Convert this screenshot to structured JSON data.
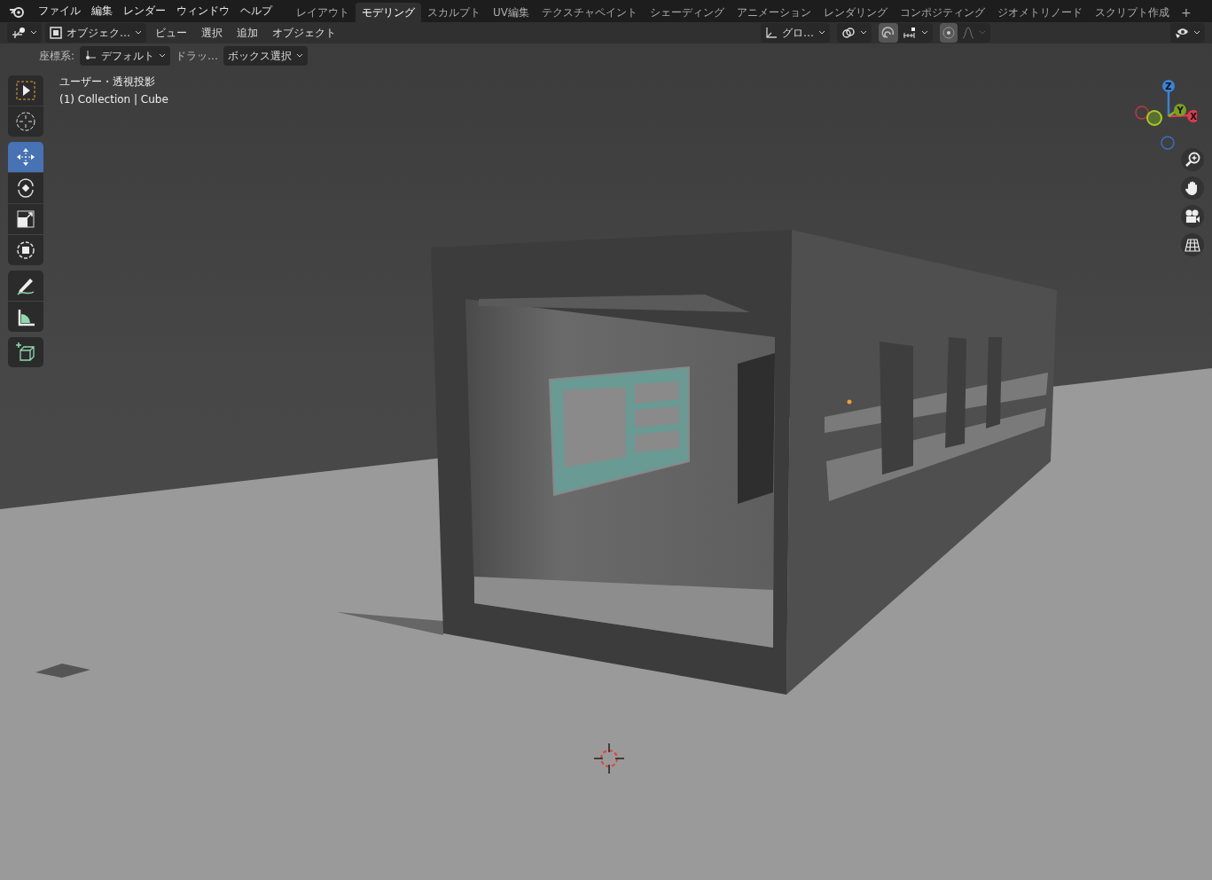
{
  "menu": {
    "items": [
      "ファイル",
      "編集",
      "レンダー",
      "ウィンドウ",
      "ヘルプ"
    ]
  },
  "workspaces": [
    {
      "label": "レイアウト",
      "selected": false
    },
    {
      "label": "モデリング",
      "selected": true
    },
    {
      "label": "スカルプト",
      "selected": false
    },
    {
      "label": "UV編集",
      "selected": false
    },
    {
      "label": "テクスチャペイント",
      "selected": false
    },
    {
      "label": "シェーディング",
      "selected": false
    },
    {
      "label": "アニメーション",
      "selected": false
    },
    {
      "label": "レンダリング",
      "selected": false
    },
    {
      "label": "コンポジティング",
      "selected": false
    },
    {
      "label": "ジオメトリノード",
      "selected": false
    },
    {
      "label": "スクリプト作成",
      "selected": false
    }
  ],
  "add_workspace": "+",
  "header": {
    "mode": "オブジェク…",
    "menus": [
      "ビュー",
      "選択",
      "追加",
      "オブジェクト"
    ],
    "orientation": "グロ…",
    "snap_on": true,
    "proportional_on": true
  },
  "tool_settings": {
    "coord_label": "座標系:",
    "coord_value": "デフォルト",
    "drag": "ドラッ…",
    "select_mode": "ボックス選択"
  },
  "tool_groups": [
    {
      "tools": [
        {
          "kind": "select",
          "selected": false
        },
        {
          "kind": "cursor",
          "selected": false
        }
      ]
    },
    {
      "tools": [
        {
          "kind": "move",
          "selected": true
        },
        {
          "kind": "rotate",
          "selected": false
        },
        {
          "kind": "scale",
          "selected": false
        },
        {
          "kind": "transform",
          "selected": false
        }
      ]
    },
    {
      "tools": [
        {
          "kind": "annotate",
          "selected": false
        },
        {
          "kind": "measure",
          "selected": false
        }
      ]
    },
    {
      "tools": [
        {
          "kind": "add_cube",
          "selected": false
        }
      ]
    }
  ],
  "viewport": {
    "view_name": "ユーザー・透視投影",
    "object_info": "(1) Collection | Cube"
  },
  "gizmo": {
    "z": "Z",
    "y": "Y",
    "x": "X"
  }
}
